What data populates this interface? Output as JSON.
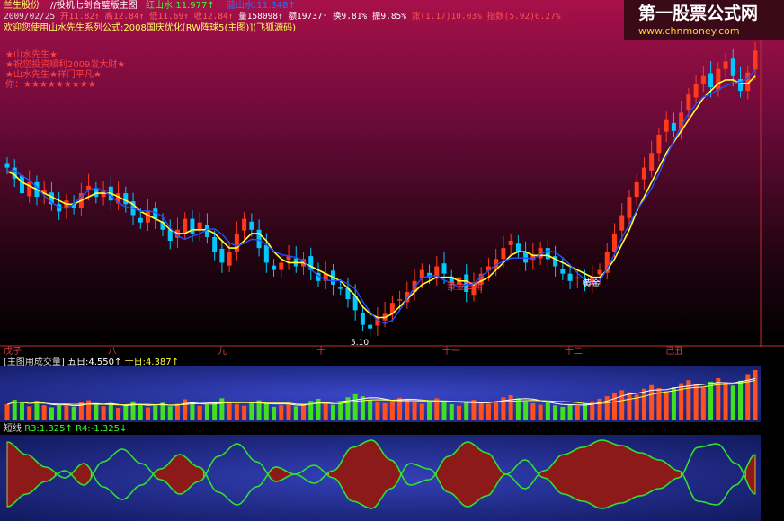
{
  "header": {
    "stock_name": "兰生股份",
    "formula_name": "//投机七剑合璧版主图",
    "red_water_label": "红山水:11.977↑",
    "blue_water_label": "蓝山水:11.348↑",
    "date": "2009/02/25",
    "open": "开11.82↑",
    "high": "高12.84↑",
    "low": "低11.69↑",
    "close": "收12.84↑",
    "volume": "量158098↑",
    "amount": "额19737↑",
    "turnover": "换9.81%",
    "amplitude": "振9.85%",
    "change": "涨(1.17)10.03%",
    "index": "指数(5.92)0.27%",
    "welcome": "欢迎您使用山水先生系列公式:2008国庆优化[RW阵球5(主图)](飞狐源码)"
  },
  "watermark": {
    "line1": "第一股票公式网",
    "line2": "www.chnmoney.com"
  },
  "colors": {
    "up": "#ff3a1a",
    "down": "#00c8ff",
    "yellow": "#ffff30",
    "blue": "#2050ff",
    "green": "#30e030",
    "dark_red_fill": "#8b1a18"
  },
  "overlay_text": {
    "star1": "★山水先生★",
    "star2": "★祝您投资顺利2009发大财★",
    "star3": "★山水先生★祥门平凡★",
    "star4": "你：★★★★★★★★★",
    "gold_triangle": "黄金三角",
    "gold": "黄金",
    "low_value": "5.10"
  },
  "axis_months": [
    "戊子",
    "八",
    "九",
    "十",
    "十一",
    "十二",
    "己丑"
  ],
  "volume_panel": {
    "title": "[主图用成交量]",
    "ma5": "五日:4.550↑",
    "ma10": "十日:4.387↑"
  },
  "osc_panel": {
    "title": "短线",
    "r3": "R3:1.325↑",
    "r4": "R4:-1.325↓"
  },
  "chart_data": {
    "type": "candlestick",
    "price_range": [
      4.8,
      13.2
    ],
    "closes": [
      9.6,
      9.3,
      8.9,
      9.2,
      8.8,
      9.0,
      8.6,
      8.4,
      8.7,
      8.5,
      8.9,
      9.1,
      8.8,
      9.0,
      8.7,
      8.9,
      8.6,
      8.3,
      8.1,
      8.4,
      8.2,
      7.9,
      7.6,
      7.9,
      8.2,
      7.8,
      8.1,
      7.7,
      7.3,
      7.0,
      7.3,
      7.8,
      8.2,
      7.9,
      7.4,
      7.0,
      6.8,
      7.0,
      7.2,
      6.9,
      7.1,
      6.8,
      6.5,
      6.7,
      6.4,
      6.3,
      6.0,
      5.7,
      5.3,
      5.2,
      5.5,
      5.6,
      5.9,
      6.0,
      6.2,
      6.5,
      6.8,
      6.6,
      6.9,
      6.7,
      6.4,
      6.6,
      6.2,
      6.4,
      6.7,
      6.9,
      7.1,
      7.4,
      7.6,
      7.3,
      7.0,
      7.2,
      7.4,
      7.1,
      6.9,
      6.7,
      6.5,
      6.6,
      6.4,
      6.6,
      6.8,
      7.3,
      7.8,
      8.3,
      8.8,
      9.2,
      9.6,
      10.0,
      10.5,
      10.9,
      10.6,
      11.1,
      11.6,
      11.9,
      12.1,
      11.8,
      12.3,
      12.5,
      12.1,
      11.7,
      12.2,
      12.8
    ],
    "ma_yellow": [
      9.5,
      9.4,
      9.2,
      9.1,
      9.0,
      8.9,
      8.8,
      8.7,
      8.6,
      8.6,
      8.7,
      8.8,
      8.9,
      8.9,
      8.9,
      8.8,
      8.7,
      8.6,
      8.4,
      8.3,
      8.2,
      8.1,
      7.9,
      7.8,
      7.8,
      7.9,
      7.9,
      7.9,
      7.8,
      7.6,
      7.4,
      7.4,
      7.6,
      7.8,
      7.8,
      7.6,
      7.3,
      7.1,
      7.0,
      7.0,
      7.0,
      6.9,
      6.8,
      6.7,
      6.6,
      6.5,
      6.3,
      6.1,
      5.8,
      5.6,
      5.5,
      5.5,
      5.6,
      5.8,
      6.0,
      6.2,
      6.4,
      6.5,
      6.6,
      6.6,
      6.6,
      6.5,
      6.5,
      6.4,
      6.5,
      6.6,
      6.8,
      7.0,
      7.2,
      7.3,
      7.3,
      7.2,
      7.2,
      7.2,
      7.1,
      7.0,
      6.9,
      6.8,
      6.7,
      6.6,
      6.6,
      6.8,
      7.1,
      7.5,
      7.9,
      8.4,
      8.8,
      9.2,
      9.6,
      10.0,
      10.3,
      10.6,
      10.9,
      11.2,
      11.5,
      11.7,
      11.9,
      12.0,
      12.0,
      11.9,
      11.9,
      12.1
    ]
  },
  "volume_data": [
    3.2,
    4.1,
    3.5,
    2.8,
    3.9,
    3.0,
    2.6,
    2.9,
    3.3,
    2.7,
    3.6,
    4.0,
    3.1,
    2.8,
    3.4,
    2.5,
    2.9,
    3.8,
    3.2,
    2.6,
    3.0,
    3.5,
    2.8,
    3.3,
    4.2,
    3.7,
    2.9,
    3.1,
    3.6,
    4.4,
    3.8,
    3.2,
    2.9,
    3.5,
    4.0,
    3.3,
    2.7,
    3.0,
    3.4,
    2.8,
    3.2,
    3.9,
    4.3,
    3.6,
    3.1,
    3.8,
    4.6,
    5.2,
    4.8,
    4.1,
    3.7,
    3.4,
    3.9,
    4.5,
    4.2,
    3.6,
    3.3,
    3.8,
    4.4,
    3.9,
    3.2,
    2.9,
    3.5,
    4.1,
    3.7,
    3.3,
    3.9,
    4.6,
    5.0,
    4.4,
    3.8,
    3.4,
    3.1,
    3.6,
    3.0,
    2.7,
    3.2,
    2.9,
    3.4,
    3.8,
    4.3,
    4.8,
    5.4,
    6.0,
    5.6,
    5.1,
    6.3,
    7.0,
    6.4,
    5.8,
    6.6,
    7.4,
    8.0,
    7.2,
    6.5,
    7.7,
    8.4,
    7.6,
    6.9,
    7.9,
    9.2,
    10.0
  ],
  "osc_knots": [
    0.9,
    0.55,
    0.2,
    -0.1,
    0.3,
    -0.35,
    -0.7,
    -0.3,
    0.15,
    0.55,
    0.2,
    -0.5,
    -0.85,
    -0.35,
    0.2,
    0.0,
    -0.25,
    0.1,
    0.75,
    0.95,
    0.4,
    -0.3,
    -0.15,
    0.5,
    0.9,
    0.6,
    0.0,
    -0.4,
    0.1,
    0.55,
    0.75,
    0.95,
    0.8,
    0.6,
    0.4,
    0.1,
    -0.75,
    -0.85,
    -0.3,
    0.55
  ]
}
